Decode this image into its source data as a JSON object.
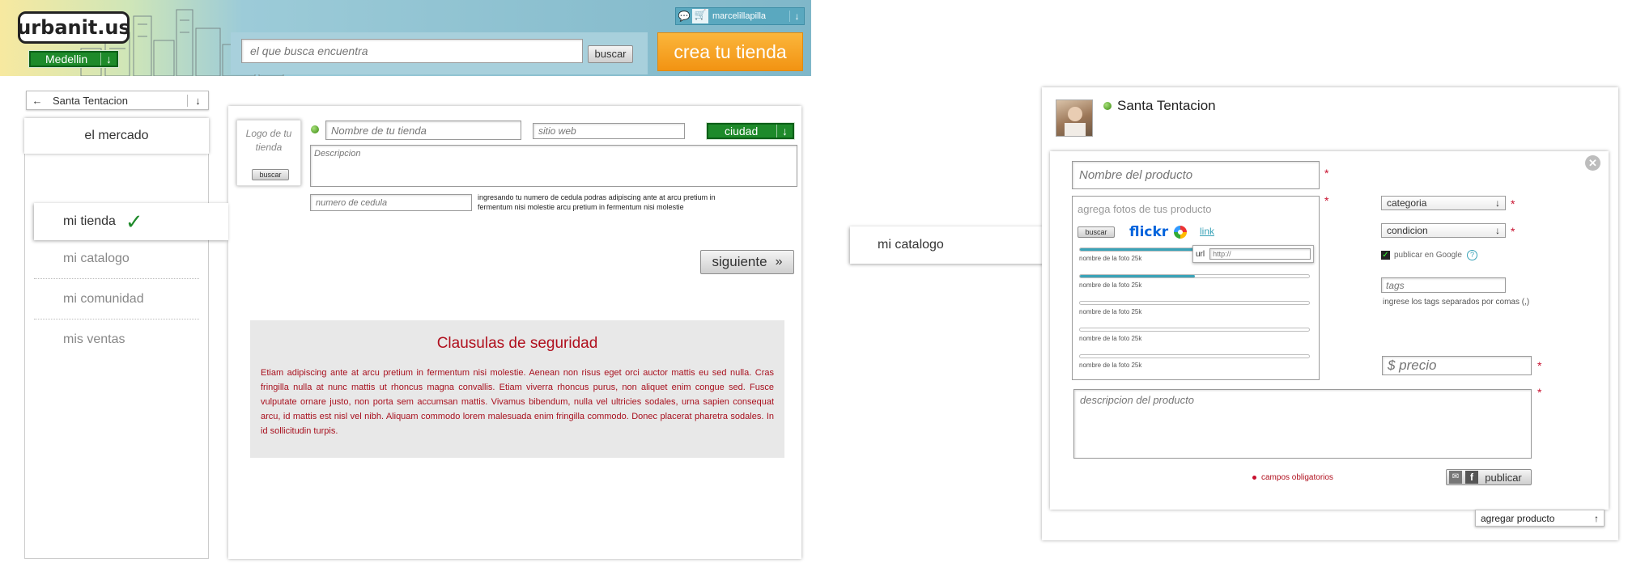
{
  "header": {
    "logo": "urbanit.us",
    "city": "Medellin",
    "search_placeholder": "el que busca encuentra",
    "search_button": "buscar",
    "cta": "crea tu tienda",
    "username": "marcelillapilla"
  },
  "store_selector": {
    "name": "Santa Tentacion"
  },
  "left_nav": {
    "mercado": "el mercado",
    "items": [
      "mi tienda",
      "mi catalogo",
      "mi comunidad",
      "mis ventas"
    ]
  },
  "store_form": {
    "logo_label": "Logo de tu tienda",
    "logo_button": "buscar",
    "name_placeholder": "Nombre de tu tienda",
    "web_placeholder": "sitio web",
    "city_label": "ciudad",
    "description_placeholder": "Descripcion",
    "id_placeholder": "numero de cedula",
    "id_help": "ingresando tu numero de cedula podras adipiscing ante at arcu pretium in fermentum nisi molestie arcu pretium in fermentum nisi molestie",
    "next_button": "siguiente"
  },
  "security": {
    "title": "Clausulas de seguridad",
    "body": "Etiam adipiscing ante at arcu pretium in fermentum nisi molestie. Aenean non risus eget orci auctor mattis eu sed nulla. Cras fringilla nulla at nunc mattis ut rhoncus magna convallis. Etiam viverra rhoncus purus, non aliquet enim congue sed. Fusce vulputate ornare justo, non porta sem accumsan mattis. Vivamus bibendum, nulla vel ultricies sodales, urna sapien consequat arcu, id mattis est nisl vel nibh. Aliquam commodo lorem malesuada enim fringilla commodo. Donec placerat pharetra sodales. In id sollicitudin turpis."
  },
  "catalog": {
    "tab_label": "mi catalogo",
    "store_name": "Santa Tentacion",
    "product_name_placeholder": "Nombre del producto",
    "photos_placeholder": "agrega fotos de tus producto",
    "photos_button": "buscar",
    "flickr": "flickr",
    "link": "link",
    "url_label": "url",
    "url_placeholder": "http://",
    "photos": [
      {
        "label": "nombre de la foto  25k",
        "progress": 0.5
      },
      {
        "label": "nombre de la foto  25k",
        "progress": 0.5
      },
      {
        "label": "nombre de la foto  25k",
        "progress": 0
      },
      {
        "label": "nombre de la foto  25k",
        "progress": 0
      },
      {
        "label": "nombre de la foto  25k",
        "progress": 0
      }
    ],
    "category": "categoria",
    "condition": "condicion",
    "google_label": "publicar en Google",
    "google_help": "?",
    "tags_placeholder": "tags",
    "tags_help": "ingrese los tags separados por comas (,)",
    "price_placeholder": "$ precio",
    "description_placeholder": "descripcion del producto",
    "required_note": "campos obligatorios",
    "publish_button": "publicar",
    "add_product": "agregar producto"
  },
  "colors": {
    "accent_green": "#1e8a2a",
    "cta_orange": "#f5a01e",
    "security_red": "#a8101e",
    "teal": "#3aa3b8"
  }
}
